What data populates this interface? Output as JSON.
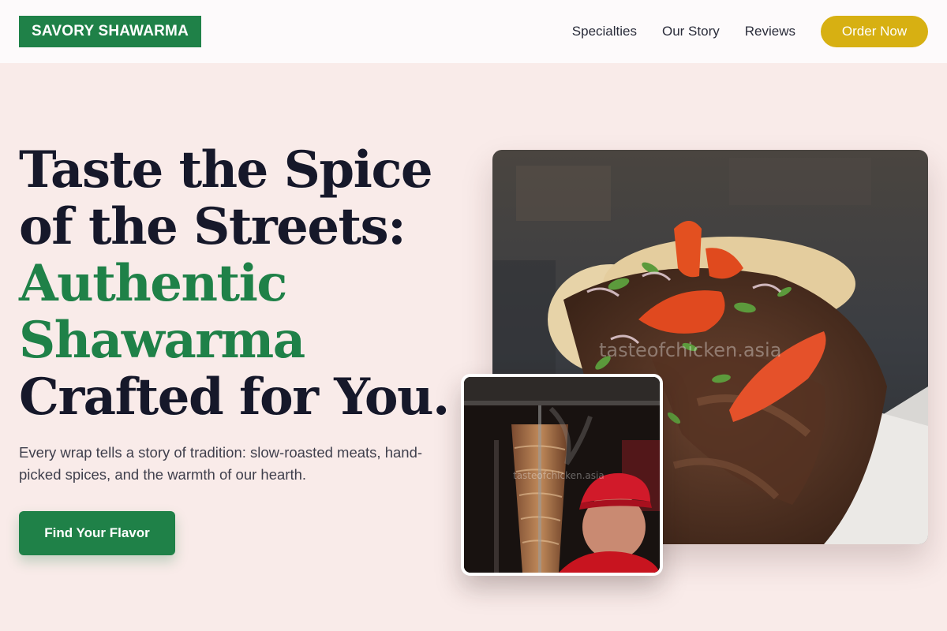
{
  "header": {
    "logo_text": "SAVORY SHAWARMA",
    "nav": [
      {
        "label": "Specialties"
      },
      {
        "label": "Our Story"
      },
      {
        "label": "Reviews"
      }
    ],
    "order_label": "Order Now"
  },
  "hero": {
    "headline_lines": [
      "Taste the Spice",
      "of the Streets:",
      "Authentic",
      "Shawarma",
      "Crafted for You."
    ],
    "subtext": "Every wrap tells a story of tradition: slow-roasted meats, hand-picked spices, and the warmth of our hearth.",
    "cta_label": "Find Your Flavor"
  },
  "images": {
    "main_watermark": "tasteofchicken.asia",
    "inset_watermark": "tasteofchicken.asia"
  },
  "colors": {
    "brand_green": "#1f8148",
    "accent_gold": "#d7b012",
    "page_background": "#f9ebe9",
    "header_background": "#fdfafb",
    "text_dark": "#16182a"
  }
}
